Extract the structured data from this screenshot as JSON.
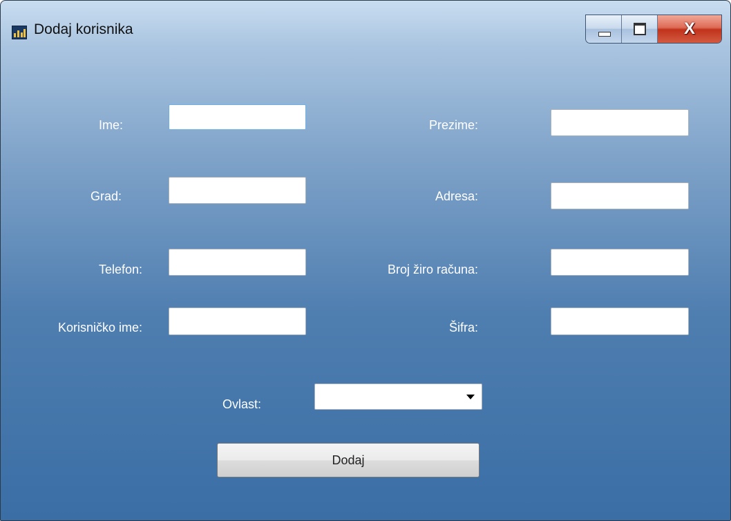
{
  "window": {
    "title": "Dodaj korisnika",
    "icon": "app-icon",
    "controls": {
      "minimize": "minimize-icon",
      "maximize": "maximize-icon",
      "close": "close-icon",
      "close_glyph": "X"
    }
  },
  "form": {
    "ime": {
      "label": "Ime:",
      "value": ""
    },
    "prezime": {
      "label": "Prezime:",
      "value": ""
    },
    "grad": {
      "label": "Grad:",
      "value": ""
    },
    "adresa": {
      "label": "Adresa:",
      "value": ""
    },
    "telefon": {
      "label": "Telefon:",
      "value": ""
    },
    "broj_ziro_racuna": {
      "label": "Broj žiro računa:",
      "value": ""
    },
    "korisnicko_ime": {
      "label": "Korisničko ime:",
      "value": ""
    },
    "sifra": {
      "label": "Šifra:",
      "value": ""
    },
    "ovlast": {
      "label": "Ovlast:",
      "selected": ""
    },
    "submit_label": "Dodaj"
  },
  "colors": {
    "client_bg": "#000000",
    "label_text": "#ffffff",
    "title_text": "#111111"
  }
}
